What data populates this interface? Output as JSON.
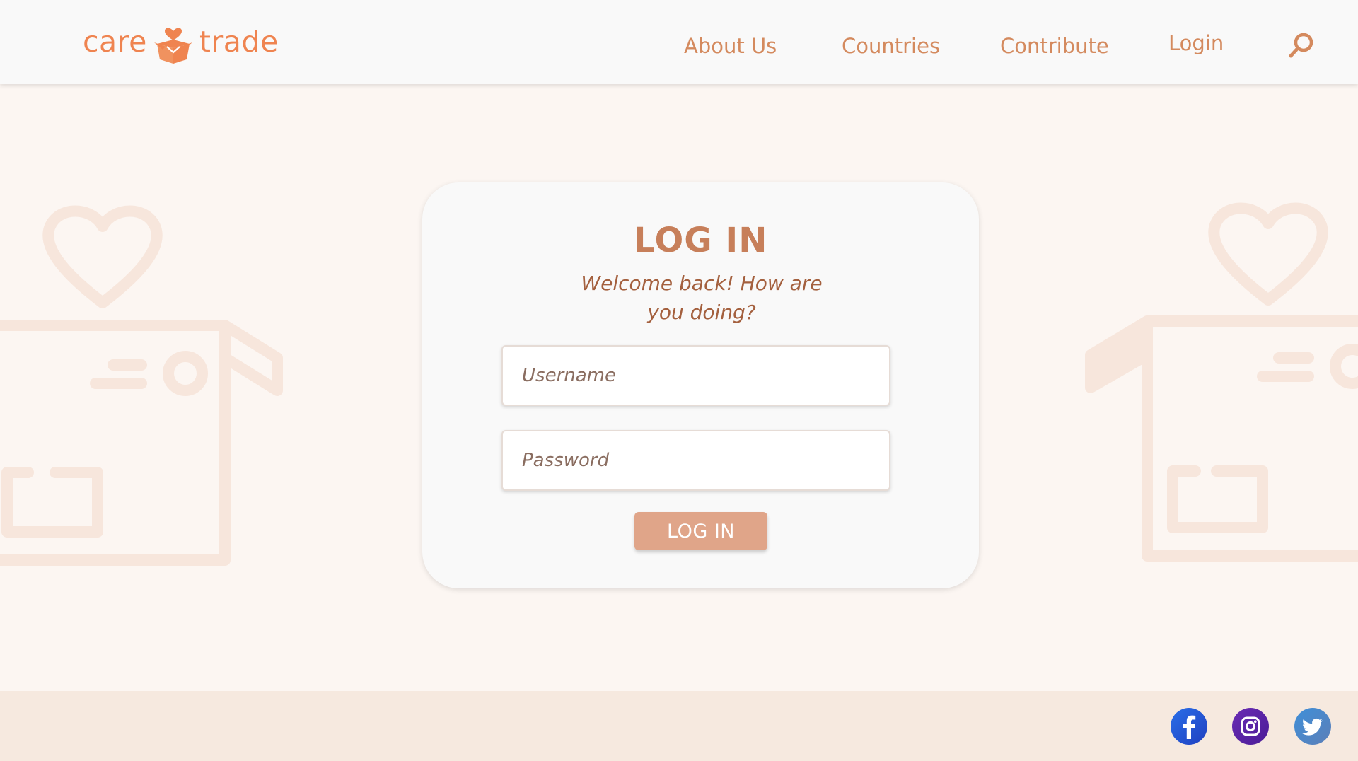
{
  "brand": {
    "word_left": "care",
    "word_right": "trade",
    "color": "#ef8450",
    "logo_icon": "heart-box-icon"
  },
  "nav": {
    "about": "About Us",
    "countries": "Countries",
    "contribute": "Contribute",
    "login": "Login",
    "search_icon": "search-icon"
  },
  "login_card": {
    "title": "LOG IN",
    "subtitle": "Welcome back! How are you doing?",
    "username_placeholder": "Username",
    "password_placeholder": "Password",
    "button_label": "LOG IN",
    "button_color": "#e0a589"
  },
  "footer": {
    "social": [
      {
        "icon": "facebook-icon"
      },
      {
        "icon": "instagram-icon"
      },
      {
        "icon": "twitter-icon"
      }
    ]
  },
  "colors": {
    "nav_text": "#d48a5e",
    "title": "#c77f5a",
    "page_bg": "#fcf6f2",
    "footer_bg": "#f6e9df"
  }
}
